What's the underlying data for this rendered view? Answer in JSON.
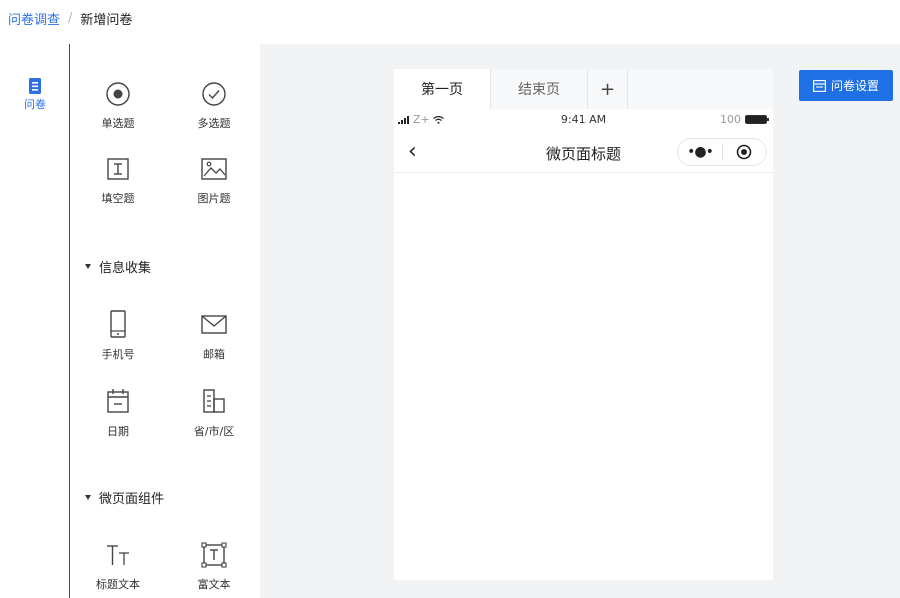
{
  "breadcrumb": {
    "parent": "问卷调查",
    "separator": "/",
    "current": "新增问卷"
  },
  "left_nav": {
    "items": [
      {
        "label": "问卷",
        "icon": "document-icon",
        "active": true
      }
    ]
  },
  "palette": {
    "basic": [
      {
        "label": "单选题",
        "icon": "radio-icon"
      },
      {
        "label": "多选题",
        "icon": "checkbox-circle-icon"
      },
      {
        "label": "填空题",
        "icon": "text-input-icon"
      },
      {
        "label": "图片题",
        "icon": "image-icon"
      }
    ],
    "info_section": {
      "title": "信息收集"
    },
    "info": [
      {
        "label": "手机号",
        "icon": "phone-icon"
      },
      {
        "label": "邮箱",
        "icon": "mail-icon"
      },
      {
        "label": "日期",
        "icon": "calendar-icon"
      },
      {
        "label": "省/市/区",
        "icon": "building-icon"
      }
    ],
    "micro_section": {
      "title": "微页面组件"
    },
    "micro": [
      {
        "label": "标题文本",
        "icon": "title-text-icon"
      },
      {
        "label": "富文本",
        "icon": "rich-text-icon"
      }
    ]
  },
  "tabs": {
    "items": [
      {
        "label": "第一页",
        "active": true
      },
      {
        "label": "结束页",
        "active": false
      }
    ],
    "add_label": "+"
  },
  "phone": {
    "status": {
      "signal": "Z+",
      "time": "9:41 AM",
      "battery": "100"
    },
    "nav": {
      "back": "‹",
      "title": "微页面标题",
      "more": "•●•"
    }
  },
  "settings_button": {
    "label": "问卷设置"
  },
  "colors": {
    "primary": "#1f6fe5",
    "canvas_bg": "#f2f3f5"
  }
}
